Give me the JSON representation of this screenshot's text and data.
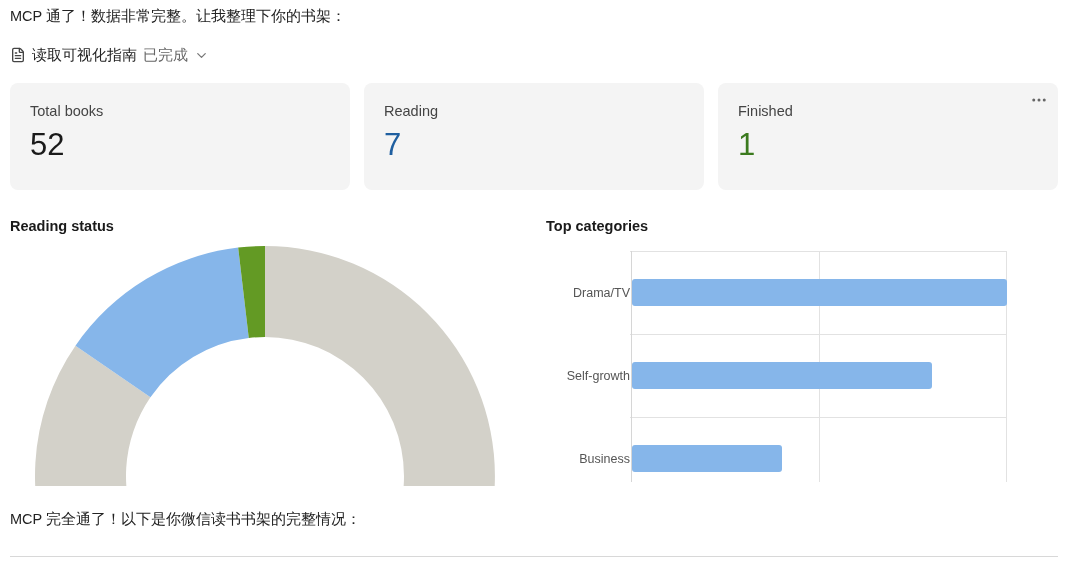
{
  "intro": "MCP 通了！数据非常完整。让我整理下你的书架：",
  "tool_step": {
    "label": "读取可视化指南",
    "status": "已完成"
  },
  "stats": [
    {
      "label": "Total books",
      "value": "52",
      "color": "#1a1a1a"
    },
    {
      "label": "Reading",
      "value": "7",
      "color": "#1f5fa0"
    },
    {
      "label": "Finished",
      "value": "1",
      "color": "#3b7a1e"
    }
  ],
  "reading_status": {
    "title": "Reading status"
  },
  "top_categories": {
    "title": "Top categories",
    "categories": [
      "Drama/TV",
      "Self-growth",
      "Business"
    ]
  },
  "outro": "MCP 完全通了！以下是你微信读书书架的完整情况："
}
